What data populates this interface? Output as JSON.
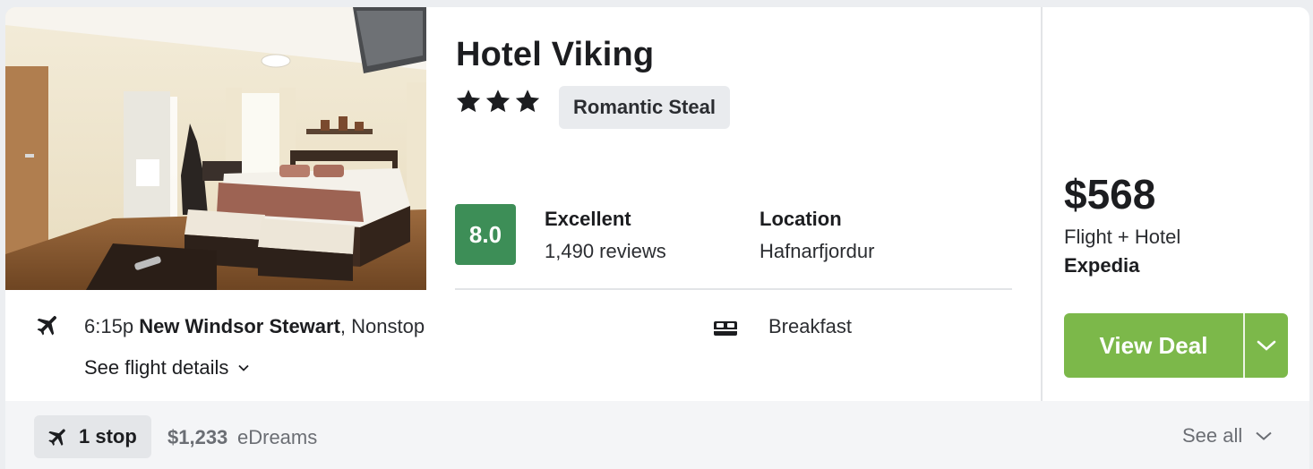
{
  "hotel": {
    "name": "Hotel Viking",
    "star_count": 3,
    "badge": "Romantic Steal"
  },
  "rating": {
    "score": "8.0",
    "label": "Excellent",
    "reviews": "1,490 reviews",
    "score_color": "#3d8e57"
  },
  "location": {
    "label": "Location",
    "value": "Hafnarfjordur"
  },
  "flight": {
    "time": "6:15p",
    "origin": "New Windsor Stewart",
    "separator": ",",
    "stops": "Nonstop",
    "details_link": "See flight details",
    "icon": "airplane-icon"
  },
  "amenity": {
    "icon": "bed-icon",
    "label": "Breakfast"
  },
  "pricing": {
    "price": "$568",
    "type": "Flight + Hotel",
    "provider": "Expedia",
    "cta": "View Deal",
    "cta_color": "#7cb84a"
  },
  "alternative": {
    "stop_label": "1 stop",
    "price": "$1,233",
    "provider": "eDreams",
    "see_all": "See all"
  }
}
